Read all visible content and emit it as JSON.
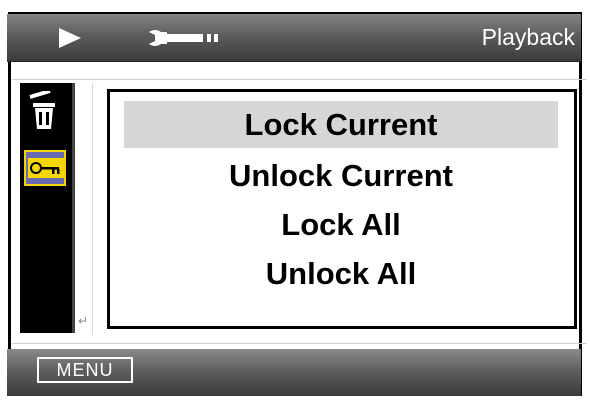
{
  "topbar": {
    "title": "Playback",
    "icons": [
      "play-icon",
      "wrench-icon"
    ]
  },
  "sidebar": {
    "items": [
      {
        "icon": "trash-icon",
        "selected": false
      },
      {
        "icon": "key-icon",
        "selected": true
      }
    ]
  },
  "menu": {
    "options": [
      {
        "label": "Lock Current",
        "selected": true
      },
      {
        "label": "Unlock Current",
        "selected": false
      },
      {
        "label": "Lock All",
        "selected": false
      },
      {
        "label": "Unlock All",
        "selected": false
      }
    ]
  },
  "bottombar": {
    "menu_label": "MENU"
  },
  "colors": {
    "bar_top": "#858585",
    "bar_bottom": "#3b3b3b",
    "selection": "#d6d6d6",
    "key_tile_border": "#f3d200",
    "key_tile_fill": "#6a6bb0"
  }
}
